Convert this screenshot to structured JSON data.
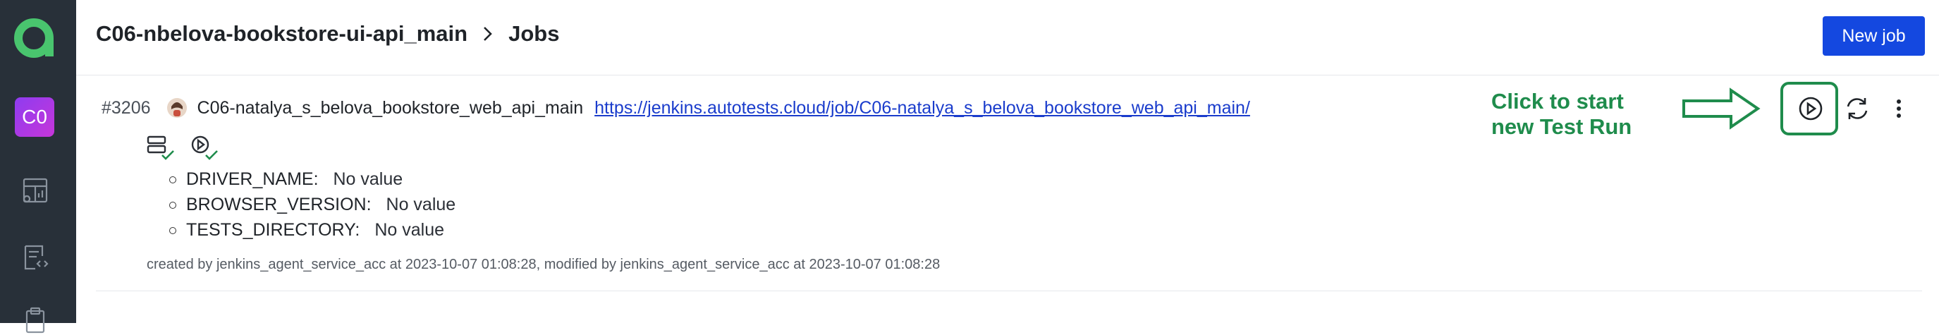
{
  "sidebar": {
    "avatar_text": "C0",
    "icons": [
      "app-logo-icon",
      "dashboard-icon",
      "code-document-icon",
      "clipboard-icon"
    ]
  },
  "header": {
    "project_name": "C06-nbelova-bookstore-ui-api_main",
    "section": "Jobs",
    "new_job_label": "New job"
  },
  "job": {
    "id": "#3206",
    "name": "C06-natalya_s_belova_bookstore_web_api_main",
    "url": "https://jenkins.autotests.cloud/job/C06-natalya_s_belova_bookstore_web_api_main/",
    "parameters": [
      {
        "name": "DRIVER_NAME:",
        "value": "No value"
      },
      {
        "name": "BROWSER_VERSION:",
        "value": "No value"
      },
      {
        "name": "TESTS_DIRECTORY:",
        "value": "No value"
      }
    ],
    "meta": "created by jenkins_agent_service_acc at 2023-10-07 01:08:28, modified by jenkins_agent_service_acc at 2023-10-07 01:08:28"
  },
  "annotation": {
    "line1": "Click to start",
    "line2": "new Test Run",
    "color": "#1f8c4c"
  },
  "colors": {
    "sidebar_bg": "#283039",
    "accent": "#1448e0",
    "link": "#1a3ccc",
    "logo": "#49c56e",
    "avatar_gradient": [
      "#8e3cf0",
      "#c636d9"
    ]
  }
}
